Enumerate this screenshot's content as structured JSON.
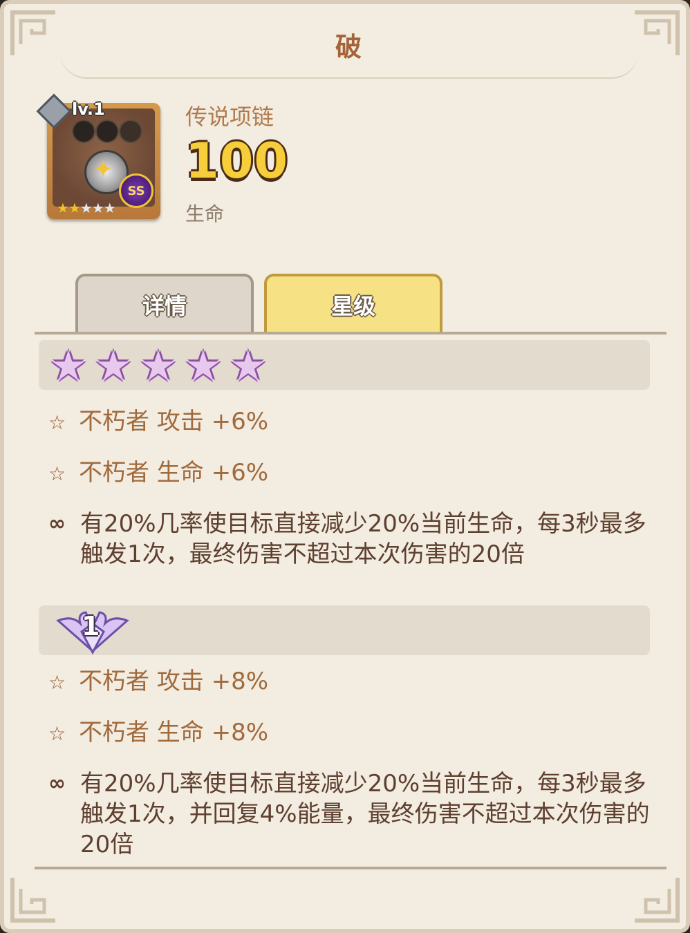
{
  "title": "破",
  "item": {
    "level": "lv.1",
    "name": "传说项链",
    "value": "100",
    "stat": "生命",
    "grade_badge": "SS",
    "stars_total": 5,
    "stars_filled": 2
  },
  "tabs": [
    {
      "label": "详情",
      "active": false
    },
    {
      "label": "星级",
      "active": true
    }
  ],
  "sections": [
    {
      "header_type": "stars",
      "star_count": 5,
      "bonuses": [
        {
          "icon": "star-outline-icon",
          "text": "不朽者 攻击 +6%"
        },
        {
          "icon": "star-outline-icon",
          "text": "不朽者 生命 +6%"
        }
      ],
      "effect": {
        "icon": "link-icon",
        "text": "有20%几率使目标直接减少20%当前生命，每3秒最多触发1次，最终伤害不超过本次伤害的20倍"
      }
    },
    {
      "header_type": "wing",
      "wing_number": "1",
      "bonuses": [
        {
          "icon": "star-outline-icon",
          "text": "不朽者 攻击 +8%"
        },
        {
          "icon": "star-outline-icon",
          "text": "不朽者 生命 +8%"
        }
      ],
      "effect": {
        "icon": "link-icon",
        "text": "有20%几率使目标直接减少20%当前生命，每3秒最多触发1次，并回复4%能量，最终伤害不超过本次伤害的20倍"
      }
    }
  ],
  "colors": {
    "title": "#a4643a",
    "value": "#f6cd3a",
    "bonus_text": "#a06a3c",
    "effect_text": "#5e4030",
    "active_tab": "#f6e184"
  }
}
